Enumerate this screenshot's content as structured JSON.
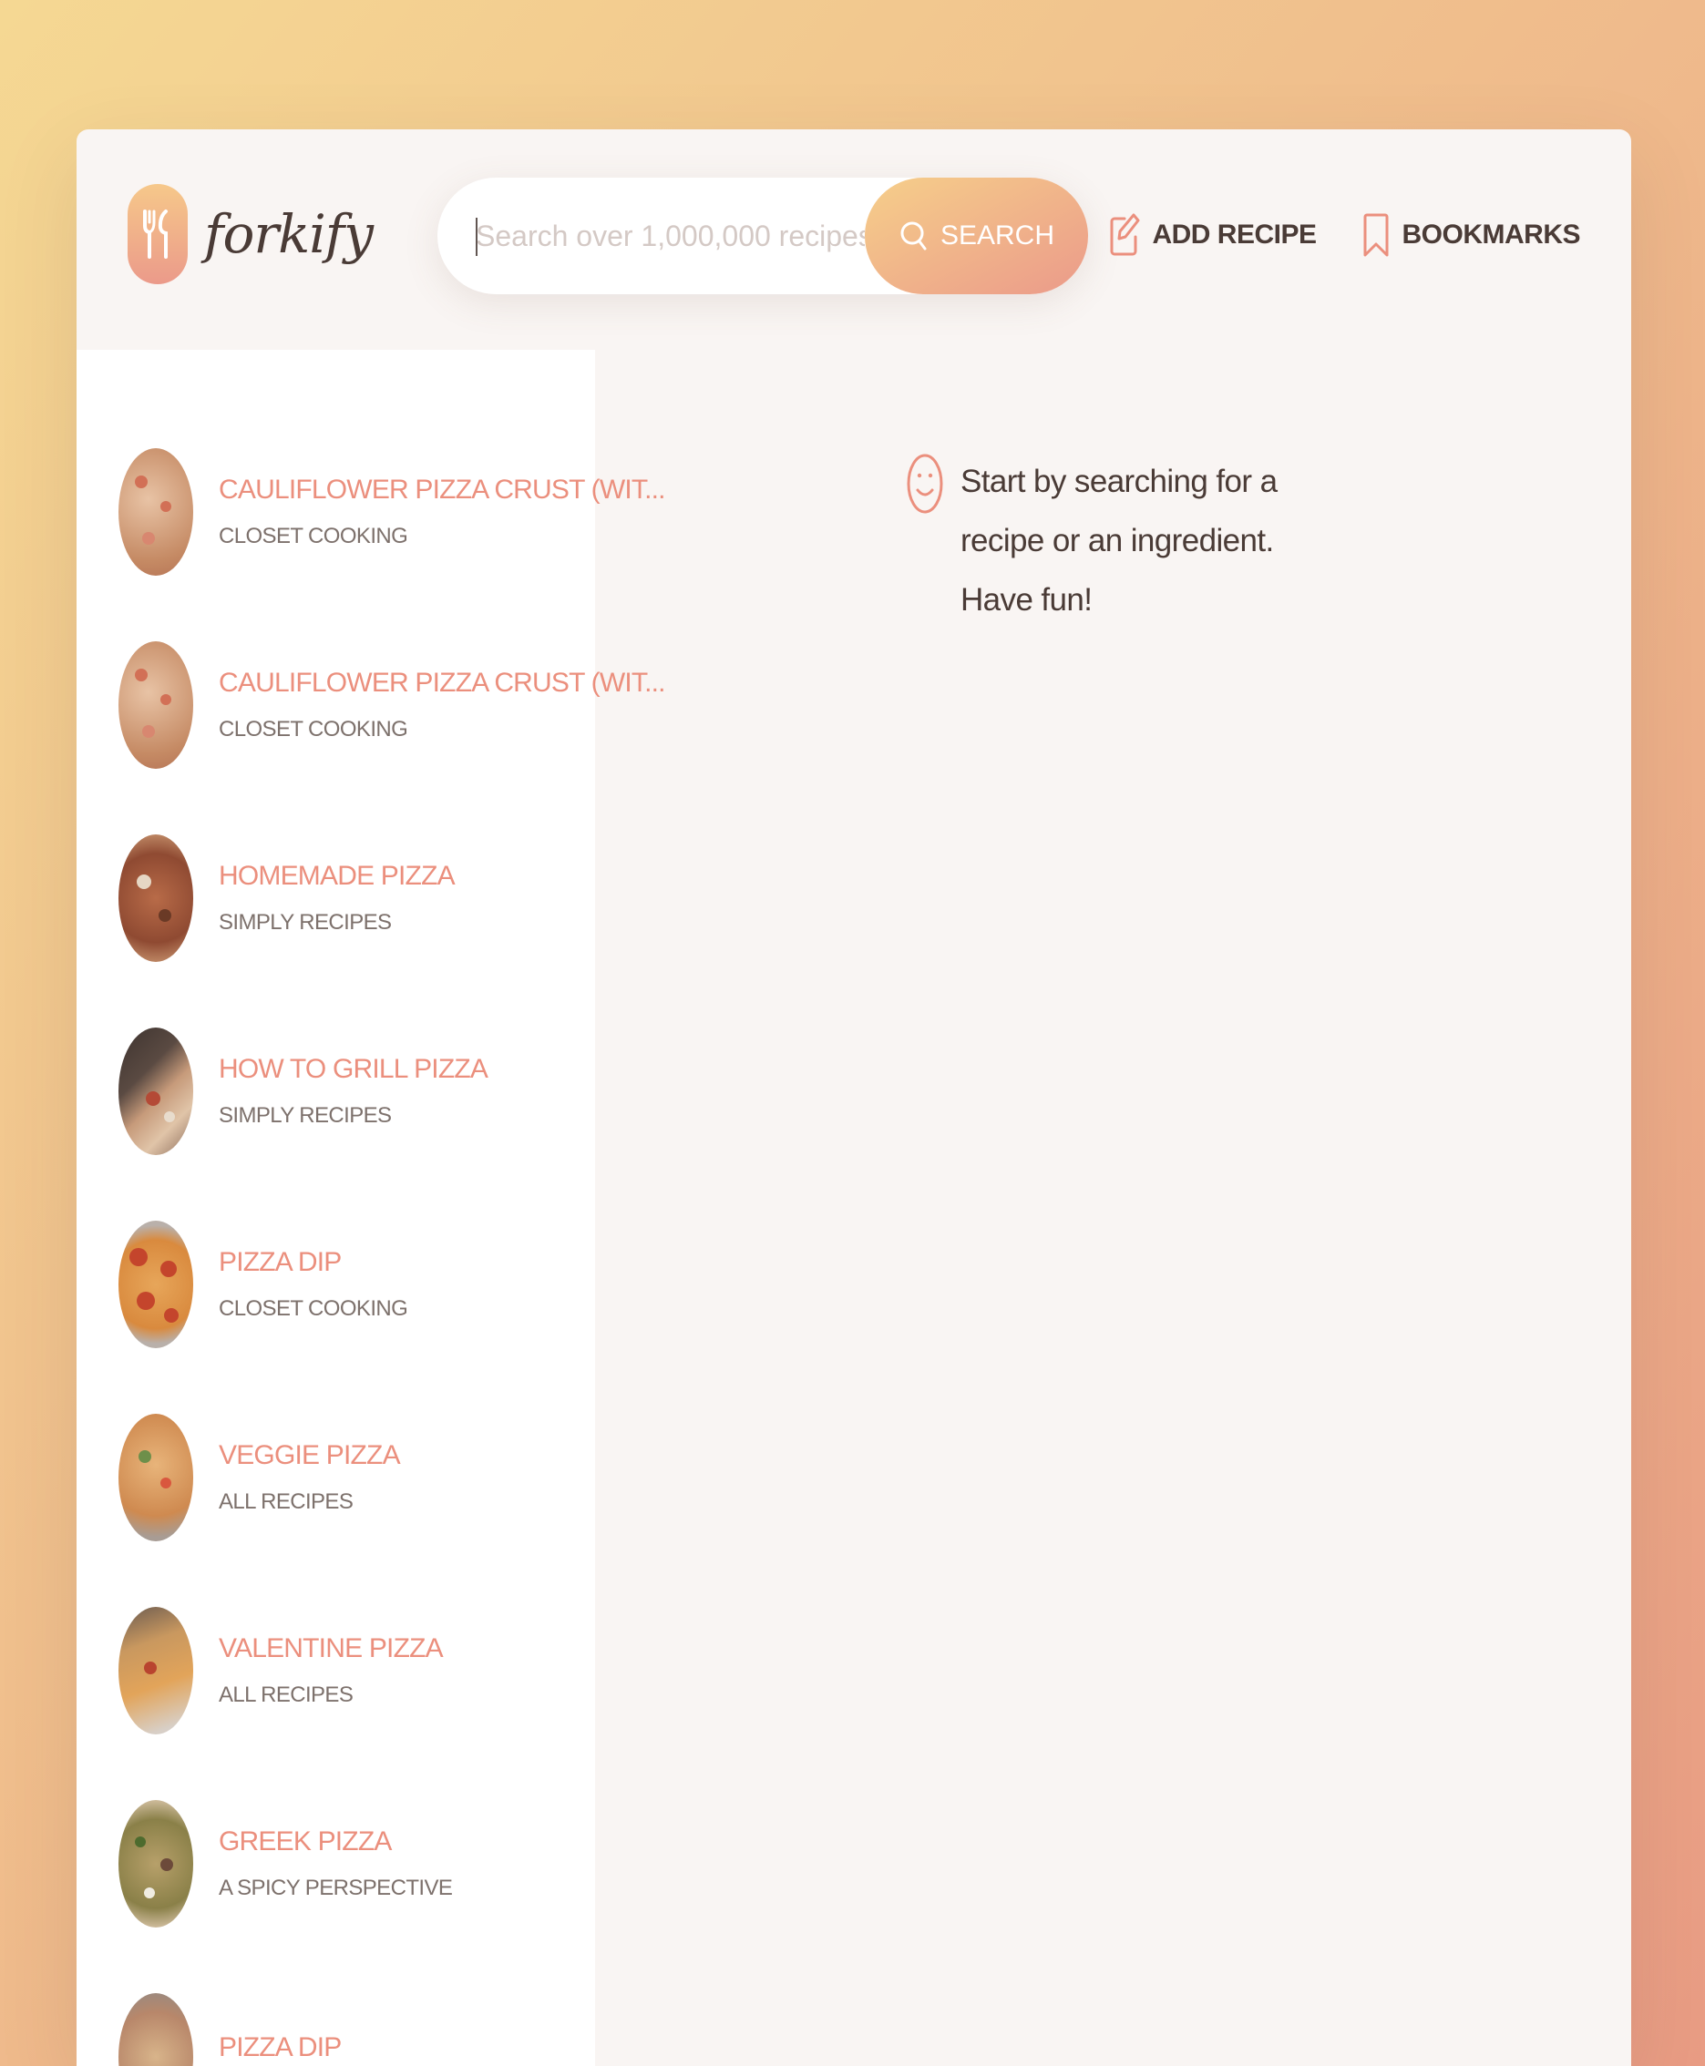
{
  "app": {
    "name": "forkify"
  },
  "search": {
    "placeholder": "Search over 1,000,000 recipes...",
    "value": "",
    "button_label": "Search"
  },
  "nav": {
    "add_recipe_label": "Add recipe",
    "bookmarks_label": "Bookmarks"
  },
  "results": [
    {
      "title": "Cauliflower Pizza Crust (wit...",
      "publisher": "Closet Cooking"
    },
    {
      "title": "Cauliflower Pizza Crust (wit...",
      "publisher": "Closet Cooking"
    },
    {
      "title": "Homemade Pizza",
      "publisher": "Simply Recipes"
    },
    {
      "title": "How to Grill Pizza",
      "publisher": "Simply Recipes"
    },
    {
      "title": "Pizza Dip",
      "publisher": "Closet Cooking"
    },
    {
      "title": "Veggie Pizza",
      "publisher": "All Recipes"
    },
    {
      "title": "Valentine Pizza",
      "publisher": "All Recipes"
    },
    {
      "title": "Greek Pizza",
      "publisher": "A Spicy Perspective"
    },
    {
      "title": "Pizza Dip",
      "publisher": ""
    }
  ],
  "message": {
    "text": "Start by searching for a recipe or an ingredient. Have fun!"
  },
  "colors": {
    "accent": "#eb8f7d",
    "gradient_start": "#f6cf8a",
    "gradient_end": "#eb9a8a",
    "text_dark": "#4a3b36"
  }
}
